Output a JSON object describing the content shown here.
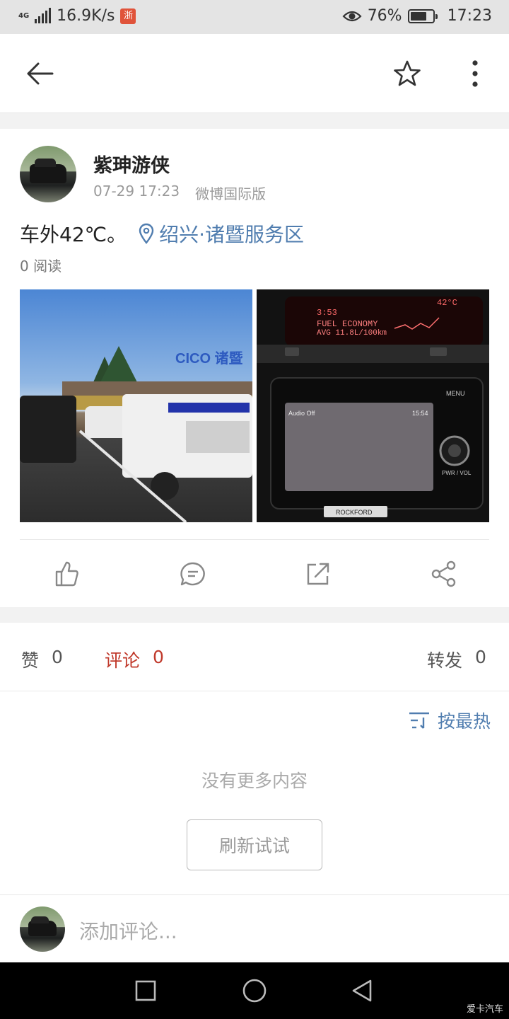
{
  "status_bar": {
    "network_type": "4G",
    "speed": "16.9K/s",
    "app_badge": "浙",
    "battery_percent": "76%",
    "battery_level": 0.76,
    "time": "17:23"
  },
  "top_bar": {
    "back_icon": "arrow-left-icon",
    "favorite_icon": "star-outline-icon",
    "more_icon": "more-vertical-icon"
  },
  "post": {
    "author": "紫珅游侠",
    "date": "07-29 17:23",
    "source": "微博国际版",
    "text": "车外42℃。",
    "location": "绍兴·诸暨服务区",
    "reads": "0 阅读",
    "images": [
      {
        "name": "service-area-photo",
        "sign_text": "CICO 诸暨"
      },
      {
        "name": "car-dashboard-photo",
        "screen_time": "15:54",
        "screen_label": "Audio Off",
        "display_line1": "FUEL ECONOMY",
        "display_line2": "AVG 11.8L/100km",
        "clock": "3:53",
        "temp": "42°C",
        "menu_label": "MENU",
        "knob_label": "PWR / VOL",
        "brand_label": "ROCKFORD"
      }
    ],
    "actions": [
      "like-icon",
      "comment-icon",
      "repost-icon",
      "share-icon"
    ]
  },
  "stats": {
    "likes_label": "赞",
    "likes_count": "0",
    "comments_label": "评论",
    "comments_count": "0",
    "reposts_label": "转发",
    "reposts_count": "0",
    "sort_label": "按最热",
    "empty_text": "没有更多内容",
    "refresh_label": "刷新试试"
  },
  "comment_bar": {
    "placeholder": "添加评论..."
  },
  "watermark": "爱卡汽车"
}
